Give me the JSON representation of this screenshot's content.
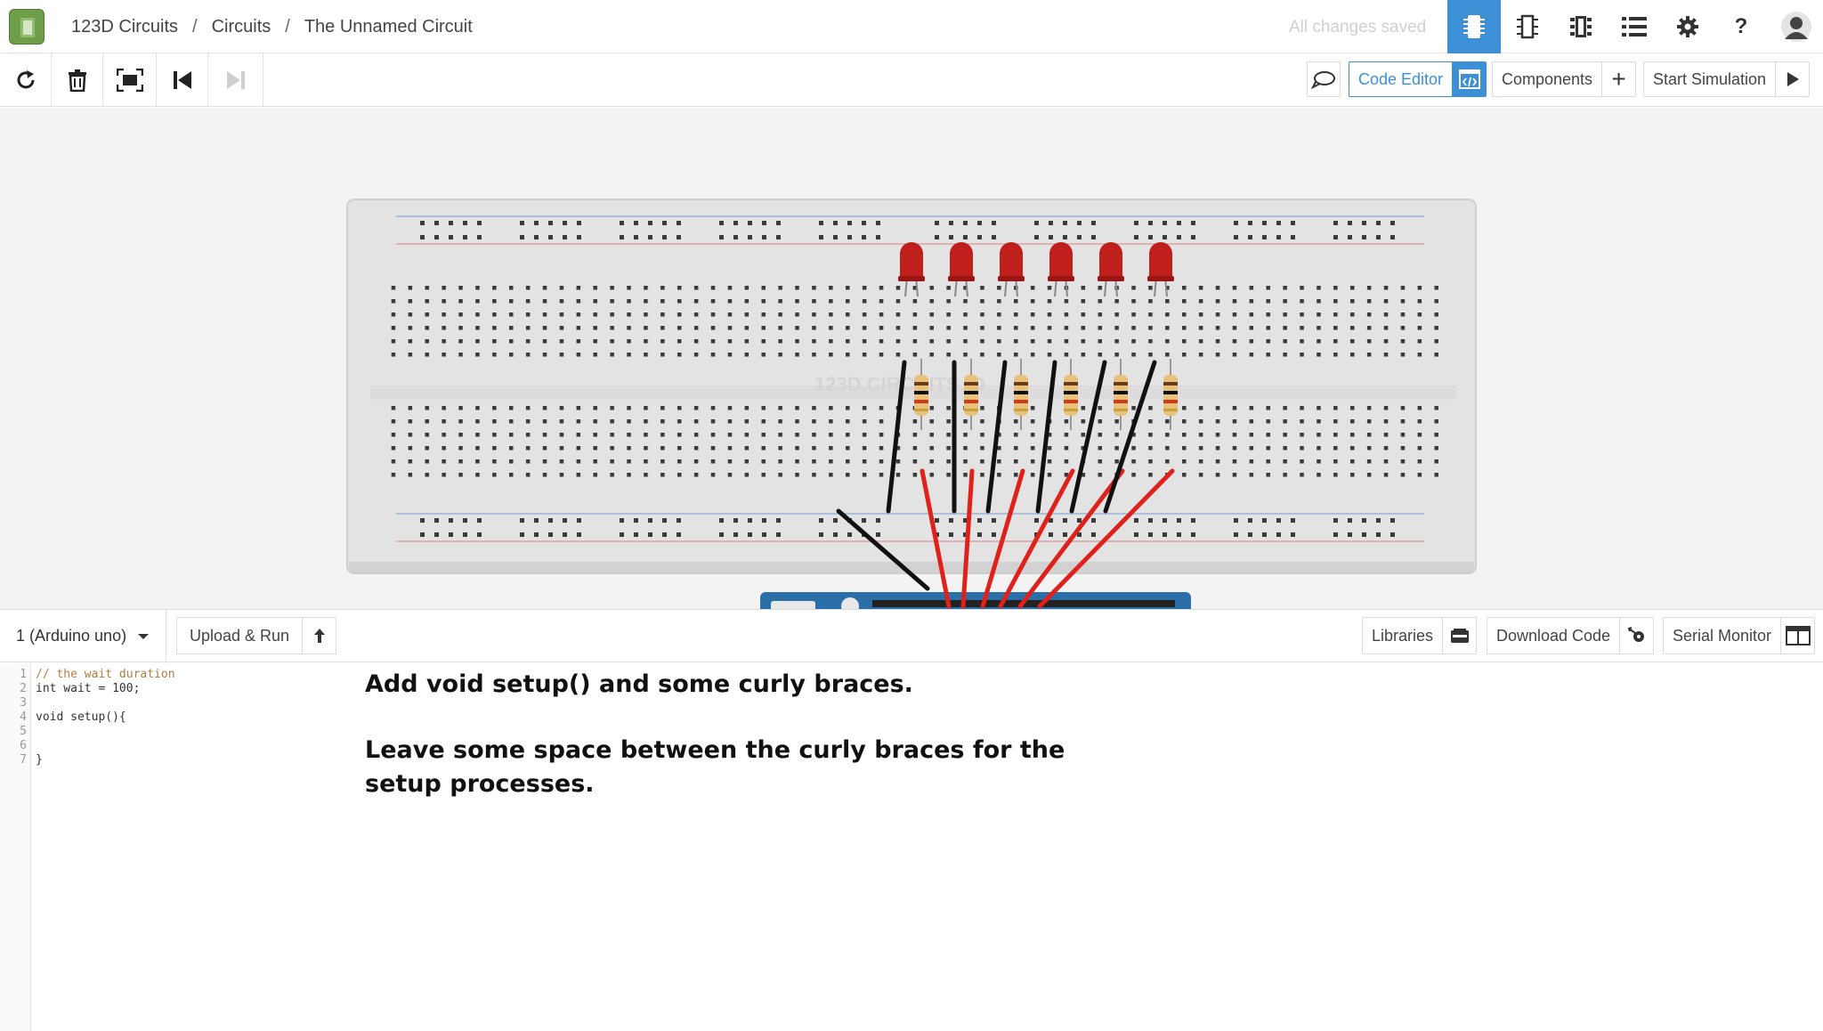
{
  "breadcrumb": {
    "items": [
      "123D Circuits",
      "Circuits",
      "The Unnamed Circuit"
    ],
    "separator": "/"
  },
  "status": {
    "saved_text": "All changes saved"
  },
  "topbar_icons": [
    "breadboard-view-icon",
    "schematic-view-icon",
    "pcb-view-icon",
    "list-view-icon",
    "settings-icon",
    "help-icon",
    "user-avatar-icon"
  ],
  "toolbar": {
    "left_icons": [
      "rotate-icon",
      "delete-icon",
      "fit-to-screen-icon",
      "step-back-icon",
      "step-forward-icon"
    ],
    "code_editor_label": "Code Editor",
    "components_label": "Components",
    "start_simulation_label": "Start Simulation"
  },
  "breadboard": {
    "watermark": "123D.CIRCUITS.IO",
    "led_count": 6,
    "resistor_count": 6
  },
  "codebar": {
    "board_select": "1 (Arduino uno)",
    "upload_label": "Upload & Run",
    "libraries_label": "Libraries",
    "download_label": "Download Code",
    "serial_label": "Serial Monitor"
  },
  "editor": {
    "line_numbers": [
      "1",
      "2",
      "3",
      "4",
      "5",
      "6",
      "7"
    ],
    "lines": [
      "// the wait duration",
      "int wait = 100;",
      "",
      "void setup(){",
      "",
      "",
      "}"
    ]
  },
  "instruction": {
    "line1": "Add void setup() and some curly braces.",
    "line2": "Leave some space between the curly braces for the",
    "line3": "setup processes."
  },
  "colors": {
    "accent": "#3d8fd6",
    "led": "#c0201c",
    "wire_red": "#e0201a",
    "wire_black": "#111111",
    "arduino": "#2a6fa8"
  }
}
